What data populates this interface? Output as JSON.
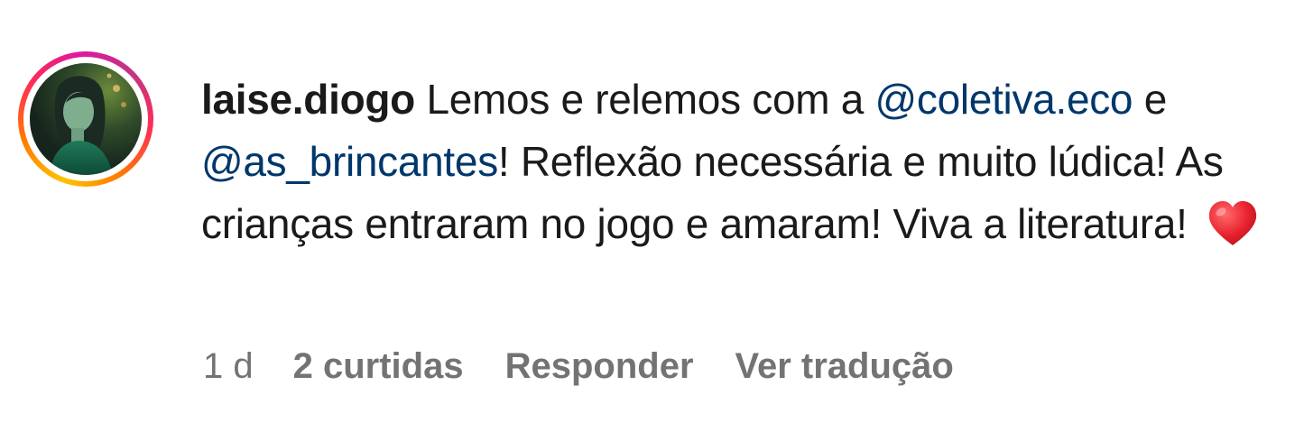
{
  "comment": {
    "username": "laise.diogo",
    "text_parts": {
      "p1": " Lemos e relemos com a ",
      "mention1": "@coletiva.eco",
      "p2": " e ",
      "mention2": "@as_brincantes",
      "p3": "! Reflexão necessária e muito lúdica! As crianças entraram no jogo e amaram! Viva a literatura!"
    },
    "emoji": "heart-icon"
  },
  "meta": {
    "time": "1 d",
    "likes": "2 curtidas",
    "reply": "Responder",
    "translate": "Ver tradução"
  },
  "colors": {
    "text": "#1a1a1a",
    "mention": "#00376b",
    "meta": "#737373",
    "heart": "#e8212e"
  }
}
